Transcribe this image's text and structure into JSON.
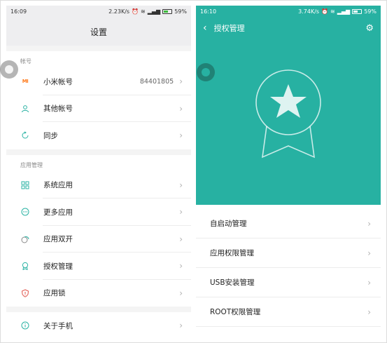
{
  "left": {
    "status": {
      "time": "16:09",
      "speed": "2.23K/s",
      "battery": "59%"
    },
    "title": "设置",
    "account_section": {
      "label": "帐号",
      "items": [
        {
          "icon": "mi-logo-icon",
          "label": "小米帐号",
          "value": "84401805"
        },
        {
          "icon": "person-icon",
          "label": "其他帐号"
        },
        {
          "icon": "sync-icon",
          "label": "同步"
        }
      ]
    },
    "apps_section": {
      "label": "应用管理",
      "items": [
        {
          "icon": "grid-icon",
          "label": "系统应用"
        },
        {
          "icon": "more-dots-icon",
          "label": "更多应用"
        },
        {
          "icon": "dual-app-icon",
          "label": "应用双开"
        },
        {
          "icon": "award-icon",
          "label": "授权管理"
        },
        {
          "icon": "shield-lock-icon",
          "label": "应用锁"
        }
      ]
    },
    "about_section": {
      "items": [
        {
          "icon": "info-icon",
          "label": "关于手机"
        }
      ]
    }
  },
  "right": {
    "status": {
      "time": "16:10",
      "speed": "3.74K/s",
      "battery": "59%"
    },
    "title": "授权管理",
    "accent": "#27b1a2",
    "items": [
      {
        "label": "自启动管理"
      },
      {
        "label": "应用权限管理"
      },
      {
        "label": "USB安装管理"
      },
      {
        "label": "ROOT权限管理"
      }
    ]
  },
  "colors": {
    "accent": "#27b1a2",
    "mi_orange": "#ff7a1a"
  }
}
